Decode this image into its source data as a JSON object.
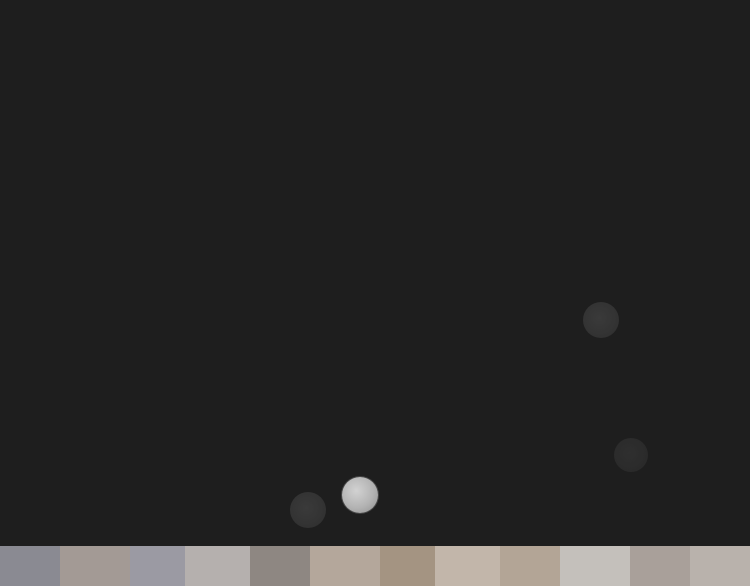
{
  "colors": {
    "background": "#1e1e1e",
    "orb_dim": "#353535",
    "orb_dimmer": "#2b2b2b",
    "orb_bright": "#b8b8b8"
  },
  "bottom_strip": {
    "tones": [
      "#8a8a92",
      "#a39a95",
      "#9b9aa3",
      "#b5b0ae",
      "#8e8782",
      "#b4a79b",
      "#a49482",
      "#c2b6aa",
      "#b3a596",
      "#c4c0bb",
      "#a9a09a",
      "#b9b2ac"
    ]
  }
}
